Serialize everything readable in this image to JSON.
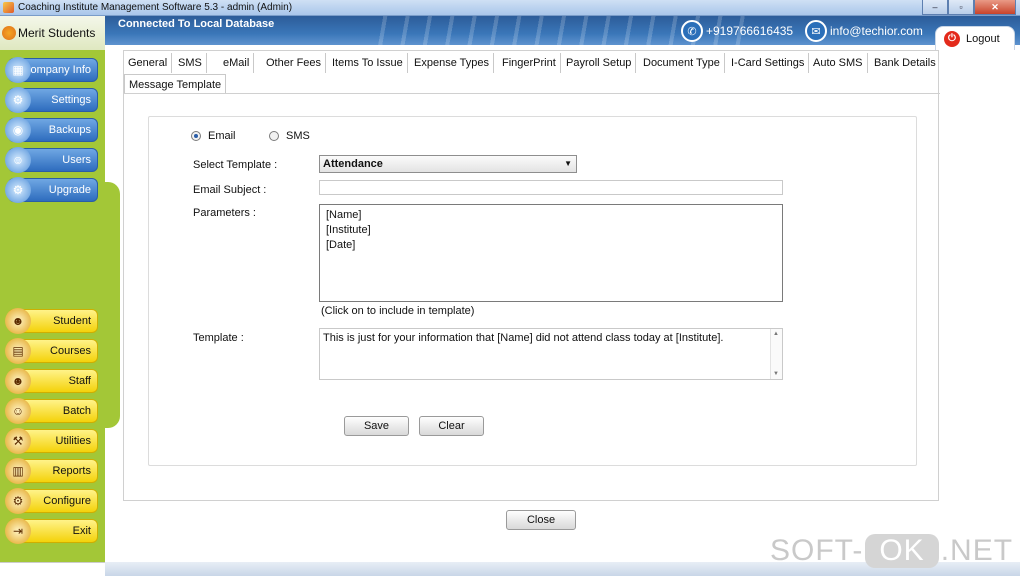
{
  "window": {
    "title": "Coaching Institute Management Software 5.3  -  admin (Admin)",
    "minimize": "–",
    "maximize": "▫",
    "close": "✕"
  },
  "header": {
    "connection": "Connected To  Local Database",
    "phone": "+919766616435",
    "email": "info@techior.com",
    "logout": "Logout"
  },
  "brand": {
    "name": "Merit Students"
  },
  "sidebar": {
    "top_items": [
      {
        "label": "Company Info",
        "icon": "company-icon"
      },
      {
        "label": "Settings",
        "icon": "settings-icon"
      },
      {
        "label": "Backups",
        "icon": "backup-icon"
      },
      {
        "label": "Users",
        "icon": "users-icon"
      },
      {
        "label": "Upgrade",
        "icon": "upgrade-icon"
      }
    ],
    "bottom_items": [
      {
        "label": "Student",
        "icon": "student-icon"
      },
      {
        "label": "Courses",
        "icon": "courses-icon"
      },
      {
        "label": "Staff",
        "icon": "staff-icon"
      },
      {
        "label": "Batch",
        "icon": "batch-icon"
      },
      {
        "label": "Utilities",
        "icon": "utilities-icon"
      },
      {
        "label": "Reports",
        "icon": "reports-icon"
      },
      {
        "label": "Configure",
        "icon": "configure-icon"
      },
      {
        "label": "Exit",
        "icon": "exit-icon"
      }
    ]
  },
  "tabs": [
    "General",
    "SMS",
    "eMail",
    "Other Fees",
    "Items To Issue",
    "Expense Types",
    "FingerPrint",
    "Payroll Setup",
    "Document Type",
    "I-Card Settings",
    "Auto SMS",
    "Bank Details",
    "Message Template"
  ],
  "active_tab": "Message Template",
  "form": {
    "radio_email": "Email",
    "radio_sms": "SMS",
    "selected_mode": "Email",
    "select_template_label": "Select Template :",
    "select_template_value": "Attendance",
    "email_subject_label": "Email Subject :",
    "email_subject_value": "",
    "parameters_label": "Parameters :",
    "parameters": [
      "[Name]",
      "[Institute]",
      "[Date]"
    ],
    "parameters_hint": "(Click on to include in template)",
    "template_label": "Template :",
    "template_value": "This is just for your information that [Name] did not attend class today at [Institute].",
    "save": "Save",
    "clear": "Clear"
  },
  "close_button": "Close",
  "watermark": {
    "left": "SOFT-",
    "mid": "OK",
    "right": ".NET"
  },
  "colors": {
    "header_blue": "#3a76b8",
    "sidebar_green": "#a3c737",
    "nav_blue": "#2e6cbe",
    "nav_yellow": "#f4d20a",
    "logout_red": "#e32a1b"
  }
}
